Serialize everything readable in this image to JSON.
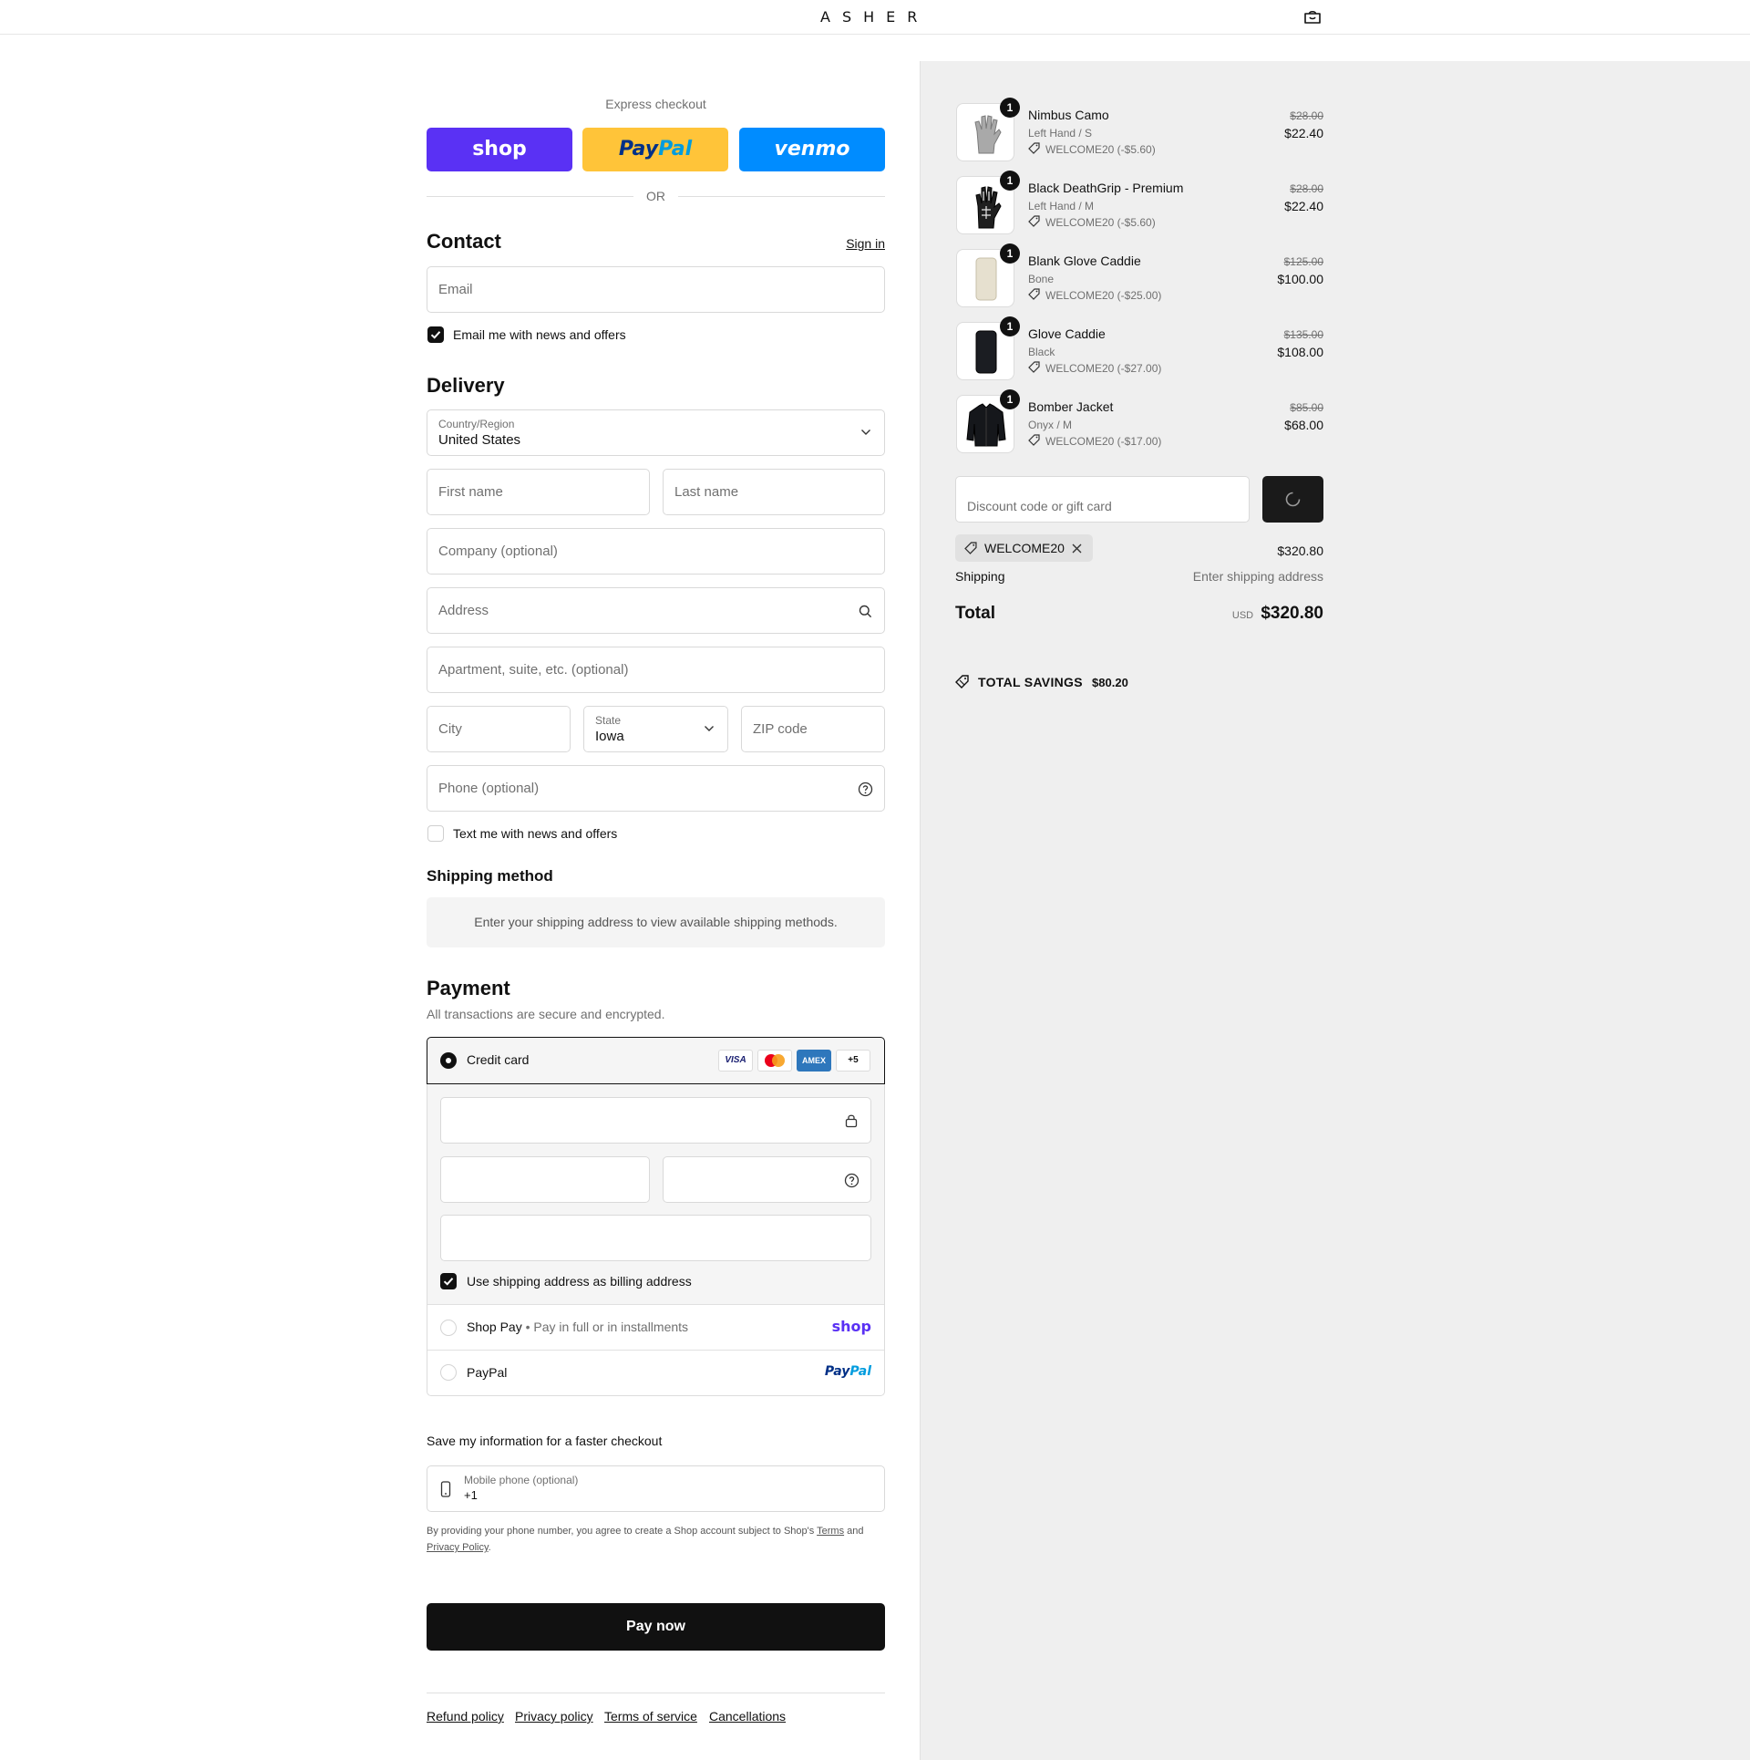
{
  "brand": {
    "name": "ASHER"
  },
  "express": {
    "title": "Express checkout",
    "shop_label": "shop",
    "paypal_label_a": "Pay",
    "paypal_label_b": "Pal",
    "venmo_label": "venmo",
    "or_label": "OR",
    "colors": {
      "shop": "#5a31f4",
      "paypal": "#ffc439",
      "venmo": "#008cff"
    }
  },
  "contact": {
    "title": "Contact",
    "sign_in": "Sign in",
    "email_placeholder": "Email",
    "newsletter_label": "Email me with news and offers",
    "newsletter_checked": true
  },
  "delivery": {
    "title": "Delivery",
    "country_label": "Country/Region",
    "country_value": "United States",
    "first_name_placeholder": "First name",
    "last_name_placeholder": "Last name",
    "company_placeholder": "Company (optional)",
    "address_placeholder": "Address",
    "apartment_placeholder": "Apartment, suite, etc. (optional)",
    "city_placeholder": "City",
    "state_label": "State",
    "state_value": "Iowa",
    "zip_placeholder": "ZIP code",
    "phone_placeholder": "Phone (optional)",
    "sms_label": "Text me with news and offers",
    "sms_checked": false
  },
  "shipping_method": {
    "title": "Shipping method",
    "message": "Enter your shipping address to view available shipping methods."
  },
  "payment": {
    "title": "Payment",
    "subtitle": "All transactions are secure and encrypted.",
    "credit_card_label": "Credit card",
    "card_brands": [
      "VISA",
      "",
      "AMEX",
      "+5"
    ],
    "billing_same_label": "Use shipping address as billing address",
    "billing_same_checked": true,
    "shop_pay_label": "Shop Pay",
    "shop_pay_sub": "Pay in full or in installments",
    "shop_pay_logo": "shop",
    "paypal_label": "PayPal",
    "paypal_logo_a": "Pay",
    "paypal_logo_b": "Pal"
  },
  "save_info": {
    "title": "Save my information for a faster checkout",
    "mobile_label": "Mobile phone (optional)",
    "mobile_value": "+1",
    "legal_prefix": "By providing your phone number, you agree to create a Shop account subject to Shop's",
    "legal_terms": "Terms",
    "legal_and": "and",
    "legal_privacy": "Privacy Policy",
    "legal_end": "."
  },
  "pay_now_label": "Pay now",
  "footer_links": [
    "Refund policy",
    "Privacy policy",
    "Terms of service",
    "Cancellations"
  ],
  "order": {
    "items": [
      {
        "name": "Nimbus Camo",
        "variant": "Left Hand / S",
        "discount": "WELCOME20 (-$5.60)",
        "old_price": "$28.00",
        "price": "$22.40",
        "qty": "1"
      },
      {
        "name": "Black DeathGrip - Premium",
        "variant": "Left Hand / M",
        "discount": "WELCOME20 (-$5.60)",
        "old_price": "$28.00",
        "price": "$22.40",
        "qty": "1"
      },
      {
        "name": "Blank Glove Caddie",
        "variant": "Bone",
        "discount": "WELCOME20 (-$25.00)",
        "old_price": "$125.00",
        "price": "$100.00",
        "qty": "1"
      },
      {
        "name": "Glove Caddie",
        "variant": "Black",
        "discount": "WELCOME20 (-$27.00)",
        "old_price": "$135.00",
        "price": "$108.00",
        "qty": "1"
      },
      {
        "name": "Bomber Jacket",
        "variant": "Onyx / M",
        "discount": "WELCOME20 (-$17.00)",
        "old_price": "$85.00",
        "price": "$68.00",
        "qty": "1"
      }
    ],
    "discount_placeholder": "Discount code or gift card",
    "applied_code": "WELCOME20",
    "subtotal": "$320.80",
    "shipping_label": "Shipping",
    "shipping_value": "Enter shipping address",
    "total_label": "Total",
    "currency": "USD",
    "total": "$320.80",
    "savings_label": "TOTAL SAVINGS",
    "savings_value": "$80.20"
  }
}
